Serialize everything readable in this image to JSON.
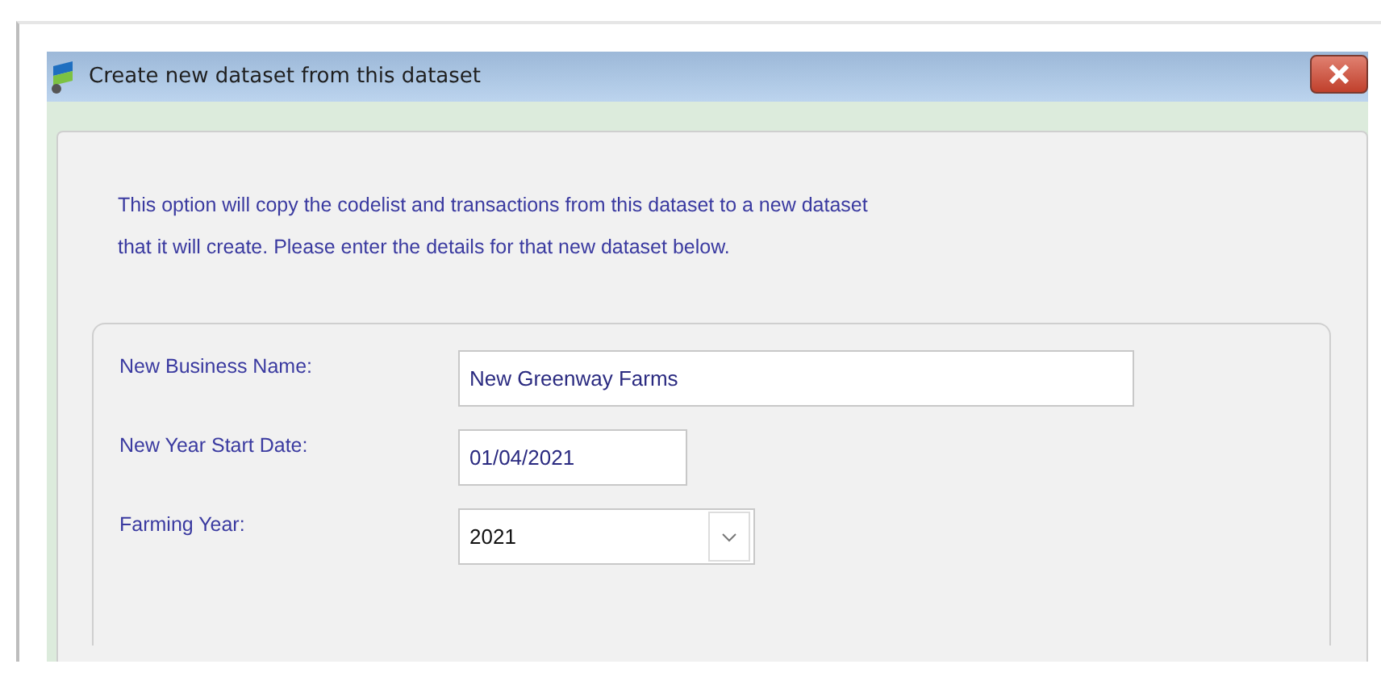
{
  "window": {
    "title": "Create new dataset from this dataset"
  },
  "intro": [
    "This option will copy the codelist and transactions from this dataset to a new dataset",
    "that it will create. Please enter the details for that new dataset below."
  ],
  "fields": [
    {
      "kind": "text",
      "label": "New Business Name:",
      "value": "New Greenway Farms"
    },
    {
      "kind": "text",
      "label": "New Year Start Date:",
      "value": "01/04/2021"
    },
    {
      "kind": "dropdown",
      "label": "Farming Year:",
      "value": "2021"
    }
  ]
}
